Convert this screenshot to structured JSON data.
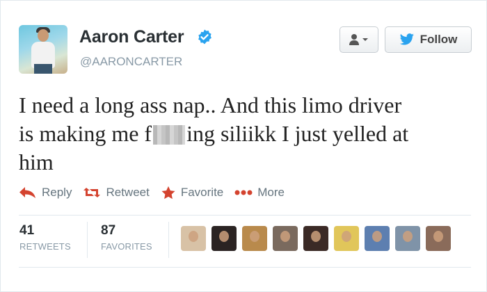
{
  "profile": {
    "name": "Aaron Carter",
    "handle": "@AARONCARTER",
    "verified_color": "#2aa3ef"
  },
  "buttons": {
    "user_menu_icon": "user-dropdown-icon",
    "follow_label": "Follow",
    "follow_icon_color": "#2aa3ef"
  },
  "tweet": {
    "line1": "I need a long ass nap.. And this limo driver",
    "line2_before": "is making me f",
    "line2_after": "ing siliikk I just yelled at",
    "line3": "him"
  },
  "actions": {
    "reply": "Reply",
    "retweet": "Retweet",
    "favorite": "Favorite",
    "more": "More",
    "accent_color": "#d4432f"
  },
  "stats": {
    "retweets_count": "41",
    "retweets_label": "RETWEETS",
    "favorites_count": "87",
    "favorites_label": "FAVORITES"
  },
  "favoriter_avatars": [
    {
      "bg": "#d8c2a6"
    },
    {
      "bg": "#2b2423"
    },
    {
      "bg": "#b98a4c"
    },
    {
      "bg": "#7a6a5e"
    },
    {
      "bg": "#3b2a26"
    },
    {
      "bg": "#e1c65a"
    },
    {
      "bg": "#5d7fb0"
    },
    {
      "bg": "#7f93a8"
    },
    {
      "bg": "#8a6b5a"
    }
  ]
}
